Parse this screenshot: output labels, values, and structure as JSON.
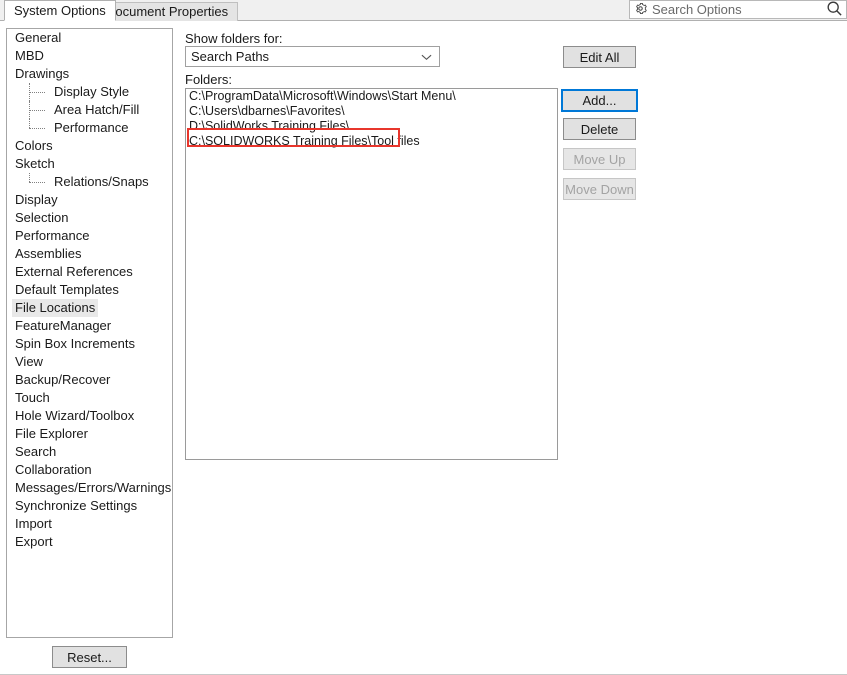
{
  "window": {
    "tabs": [
      {
        "label": "System Options",
        "active": true
      },
      {
        "label": "Document Properties",
        "active": false
      }
    ],
    "search": {
      "placeholder": "Search Options",
      "gear_icon": "gear-icon",
      "magnifier_icon": "search-icon"
    }
  },
  "sidebar": {
    "items": [
      {
        "label": "General",
        "level": 0,
        "selected": false
      },
      {
        "label": "MBD",
        "level": 0,
        "selected": false
      },
      {
        "label": "Drawings",
        "level": 0,
        "selected": false
      },
      {
        "label": "Display Style",
        "level": 1,
        "selected": false
      },
      {
        "label": "Area Hatch/Fill",
        "level": 1,
        "selected": false
      },
      {
        "label": "Performance",
        "level": 1,
        "selected": false,
        "last": true
      },
      {
        "label": "Colors",
        "level": 0,
        "selected": false
      },
      {
        "label": "Sketch",
        "level": 0,
        "selected": false
      },
      {
        "label": "Relations/Snaps",
        "level": 1,
        "selected": false,
        "last": true
      },
      {
        "label": "Display",
        "level": 0,
        "selected": false
      },
      {
        "label": "Selection",
        "level": 0,
        "selected": false
      },
      {
        "label": "Performance",
        "level": 0,
        "selected": false
      },
      {
        "label": "Assemblies",
        "level": 0,
        "selected": false
      },
      {
        "label": "External References",
        "level": 0,
        "selected": false
      },
      {
        "label": "Default Templates",
        "level": 0,
        "selected": false
      },
      {
        "label": "File Locations",
        "level": 0,
        "selected": true
      },
      {
        "label": "FeatureManager",
        "level": 0,
        "selected": false
      },
      {
        "label": "Spin Box Increments",
        "level": 0,
        "selected": false
      },
      {
        "label": "View",
        "level": 0,
        "selected": false
      },
      {
        "label": "Backup/Recover",
        "level": 0,
        "selected": false
      },
      {
        "label": "Touch",
        "level": 0,
        "selected": false
      },
      {
        "label": "Hole Wizard/Toolbox",
        "level": 0,
        "selected": false
      },
      {
        "label": "File Explorer",
        "level": 0,
        "selected": false
      },
      {
        "label": "Search",
        "level": 0,
        "selected": false
      },
      {
        "label": "Collaboration",
        "level": 0,
        "selected": false
      },
      {
        "label": "Messages/Errors/Warnings",
        "level": 0,
        "selected": false
      },
      {
        "label": "Synchronize Settings",
        "level": 0,
        "selected": false
      },
      {
        "label": "Import",
        "level": 0,
        "selected": false
      },
      {
        "label": "Export",
        "level": 0,
        "selected": false
      }
    ]
  },
  "main": {
    "show_folders_label": "Show folders for:",
    "folders_label": "Folders:",
    "combo": {
      "value": "Search Paths",
      "chevron_icon": "chevron-down-icon"
    },
    "folders": [
      {
        "path": "C:\\ProgramData\\Microsoft\\Windows\\Start Menu\\",
        "highlighted": false
      },
      {
        "path": "C:\\Users\\dbarnes\\Favorites\\",
        "highlighted": false
      },
      {
        "path": "D:\\SolidWorks Training Files\\",
        "highlighted": false
      },
      {
        "path": "C:\\SOLIDWORKS Training Files\\Tool files",
        "highlighted": true
      }
    ],
    "annotation": {
      "color": "#e8362c",
      "target_index": 3
    },
    "buttons": {
      "edit_all": {
        "label": "Edit All",
        "disabled": false,
        "focused": false
      },
      "add": {
        "label": "Add...",
        "disabled": false,
        "focused": true
      },
      "delete": {
        "label": "Delete",
        "disabled": false,
        "focused": false
      },
      "move_up": {
        "label": "Move Up",
        "disabled": true,
        "focused": false
      },
      "move_down": {
        "label": "Move Down",
        "disabled": true,
        "focused": false
      }
    }
  },
  "footer": {
    "reset": {
      "label": "Reset...",
      "disabled": false
    }
  },
  "colors": {
    "accent_focus": "#0078d7",
    "annotation_red": "#e8362c",
    "selection_gray": "#e8e8e8",
    "button_face": "#e1e1e1"
  }
}
